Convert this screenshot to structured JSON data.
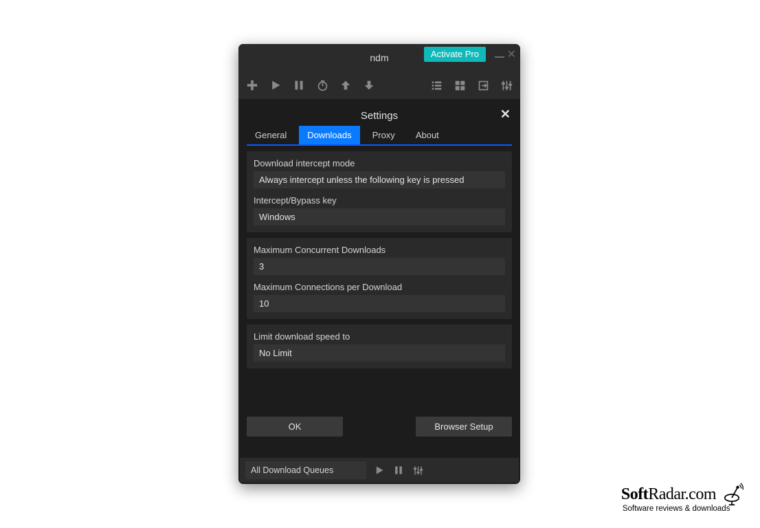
{
  "window": {
    "title": "ndm",
    "activate_label": "Activate Pro"
  },
  "settings": {
    "title": "Settings",
    "tabs": [
      "General",
      "Downloads",
      "Proxy",
      "About"
    ],
    "active_tab": "Downloads",
    "intercept": {
      "mode_label": "Download intercept mode",
      "mode_value": "Always intercept unless the following key is pressed",
      "key_label": "Intercept/Bypass key",
      "key_value": "Windows"
    },
    "limits": {
      "max_concurrent_label": "Maximum Concurrent Downloads",
      "max_concurrent_value": "3",
      "max_conn_label": "Maximum Connections per Download",
      "max_conn_value": "10"
    },
    "speed": {
      "label": "Limit download speed to",
      "value": "No Limit"
    },
    "buttons": {
      "ok": "OK",
      "browser_setup": "Browser Setup"
    }
  },
  "bottombar": {
    "queue_label": "All Download Queues"
  },
  "watermark": {
    "brand_bold": "Soft",
    "brand_rest": "Radar",
    "brand_tld": ".com",
    "tagline": "Software reviews & downloads"
  }
}
